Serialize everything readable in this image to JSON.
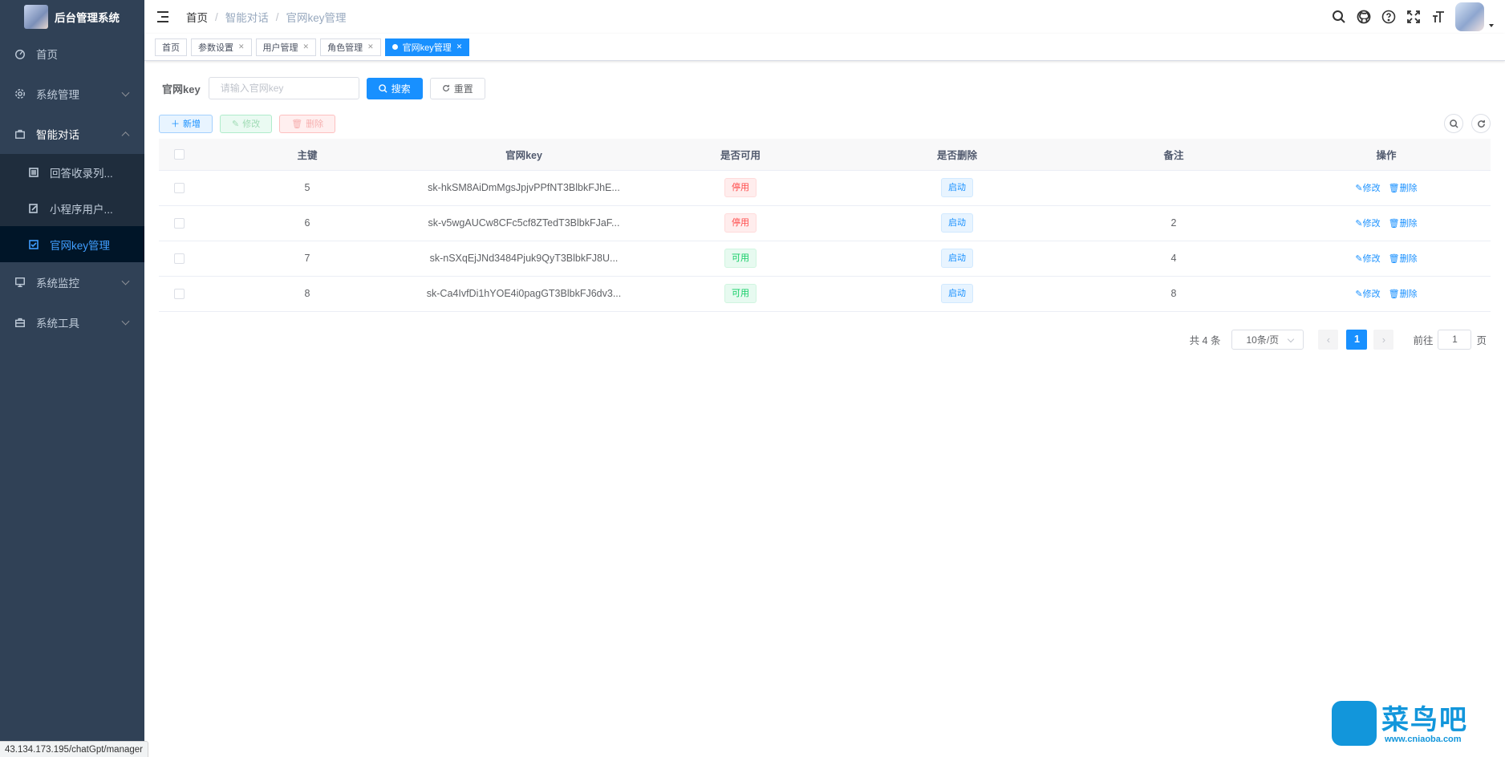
{
  "app": {
    "title": "后台管理系统"
  },
  "sidebar": {
    "items": [
      {
        "label": "首页"
      },
      {
        "label": "系统管理"
      },
      {
        "label": "智能对话",
        "children": [
          {
            "label": "回答收录列..."
          },
          {
            "label": "小程序用户..."
          },
          {
            "label": "官网key管理"
          }
        ]
      },
      {
        "label": "系统监控"
      },
      {
        "label": "系统工具"
      }
    ]
  },
  "breadcrumb": [
    "首页",
    "智能对话",
    "官网key管理"
  ],
  "tags": [
    "首页",
    "参数设置",
    "用户管理",
    "角色管理",
    "官网key管理"
  ],
  "search": {
    "label": "官网key",
    "placeholder": "请输入官网key",
    "search_btn": "搜索",
    "reset_btn": "重置"
  },
  "toolbar": {
    "add": "新增",
    "edit": "修改",
    "delete": "删除"
  },
  "table": {
    "headers": [
      "主键",
      "官网key",
      "是否可用",
      "是否删除",
      "备注",
      "操作"
    ],
    "rows": [
      {
        "id": "5",
        "key": "sk-hkSM8AiDmMgsJpjvPPfNT3BlbkFJhE...",
        "usable": "停用",
        "usable_color": "#ff4949",
        "deleted": "启动",
        "remark": ""
      },
      {
        "id": "6",
        "key": "sk-v5wgAUCw8CFc5cf8ZTedT3BlbkFJaF...",
        "usable": "停用",
        "usable_color": "#ff4949",
        "deleted": "启动",
        "remark": "2"
      },
      {
        "id": "7",
        "key": "sk-nSXqEjJNd3484Pjuk9QyT3BlbkFJ8U...",
        "usable": "可用",
        "usable_color": "#13ce66",
        "deleted": "启动",
        "remark": "4"
      },
      {
        "id": "8",
        "key": "sk-Ca4IvfDi1hYOE4i0pagGT3BlbkFJ6dv3...",
        "usable": "可用",
        "usable_color": "#13ce66",
        "deleted": "启动",
        "remark": "8"
      }
    ],
    "op_edit": "修改",
    "op_delete": "删除"
  },
  "pagination": {
    "total": "共 4 条",
    "page_size": "10条/页",
    "current": "1",
    "goto_prefix": "前往",
    "goto_value": "1",
    "goto_suffix": "页"
  },
  "statusbar": {
    "url": "43.134.173.195/chatGpt/manager"
  },
  "watermark": {
    "name": "菜鸟吧",
    "url": "www.cniaoba.com"
  },
  "colors": {
    "sidebar": "#304156",
    "accent": "#1890ff",
    "danger": "#ff4949",
    "success": "#13ce66"
  }
}
